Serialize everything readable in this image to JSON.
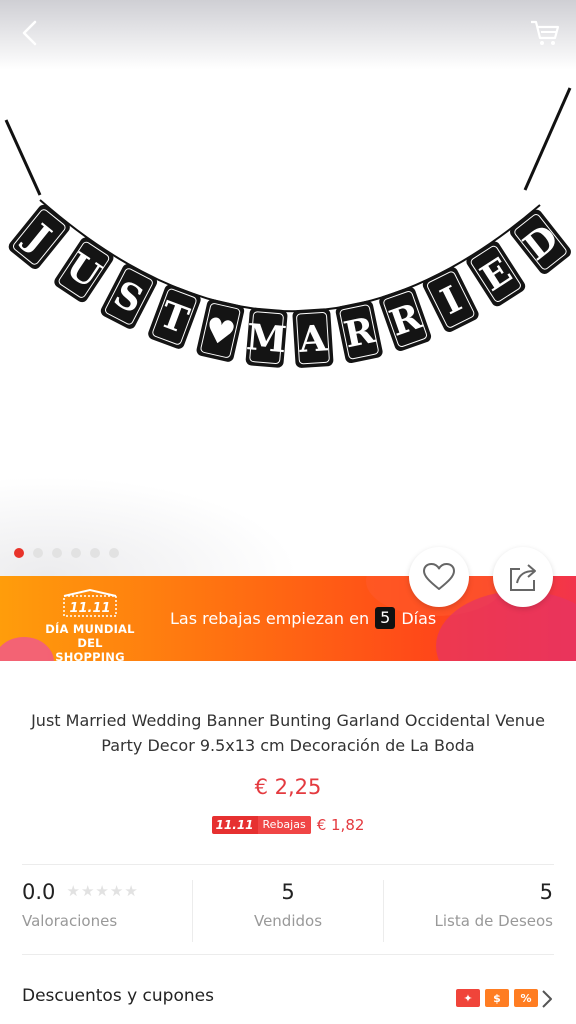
{
  "nav": {
    "back_icon": "chevron-left-icon",
    "cart_icon": "shopping-cart-icon"
  },
  "banner_letters": [
    "J",
    "U",
    "S",
    "T",
    "♥",
    "M",
    "A",
    "R",
    "R",
    "I",
    "E",
    "D"
  ],
  "gallery": {
    "image_count": 6,
    "active_index": 0
  },
  "promo": {
    "logo_mark": "11.11",
    "logo_line1": "DÍA MUNDIAL",
    "logo_line2": "DEL SHOPPING",
    "text": "Las rebajas empiezan en",
    "days_value": "5",
    "days_label": "Días"
  },
  "actions": {
    "wishlist_icon": "heart-icon",
    "share_icon": "share-icon"
  },
  "product": {
    "title": "Just Married Wedding Banner Bunting Garland Occidental Venue Party Decor 9.5x13 cm Decoración de La Boda",
    "price": "€ 2,25",
    "sale_badge_mark": "11.11",
    "sale_badge_label": "Rebajas",
    "sale_price": "€ 1,82"
  },
  "stats": {
    "rating_value": "0.0",
    "rating_stars": 0,
    "rating_label": "Valoraciones",
    "sold_value": "5",
    "sold_label": "Vendidos",
    "wishlist_value": "5",
    "wishlist_label": "Lista de Deseos"
  },
  "coupons": {
    "label": "Descuentos y cupones",
    "icons": [
      "sparkle-coupon-icon",
      "dollar-coupon-icon",
      "percent-coupon-icon"
    ]
  },
  "colors": {
    "accent": "#e43a3f",
    "promo_start": "#ff9d0b",
    "promo_end": "#f2344c"
  }
}
